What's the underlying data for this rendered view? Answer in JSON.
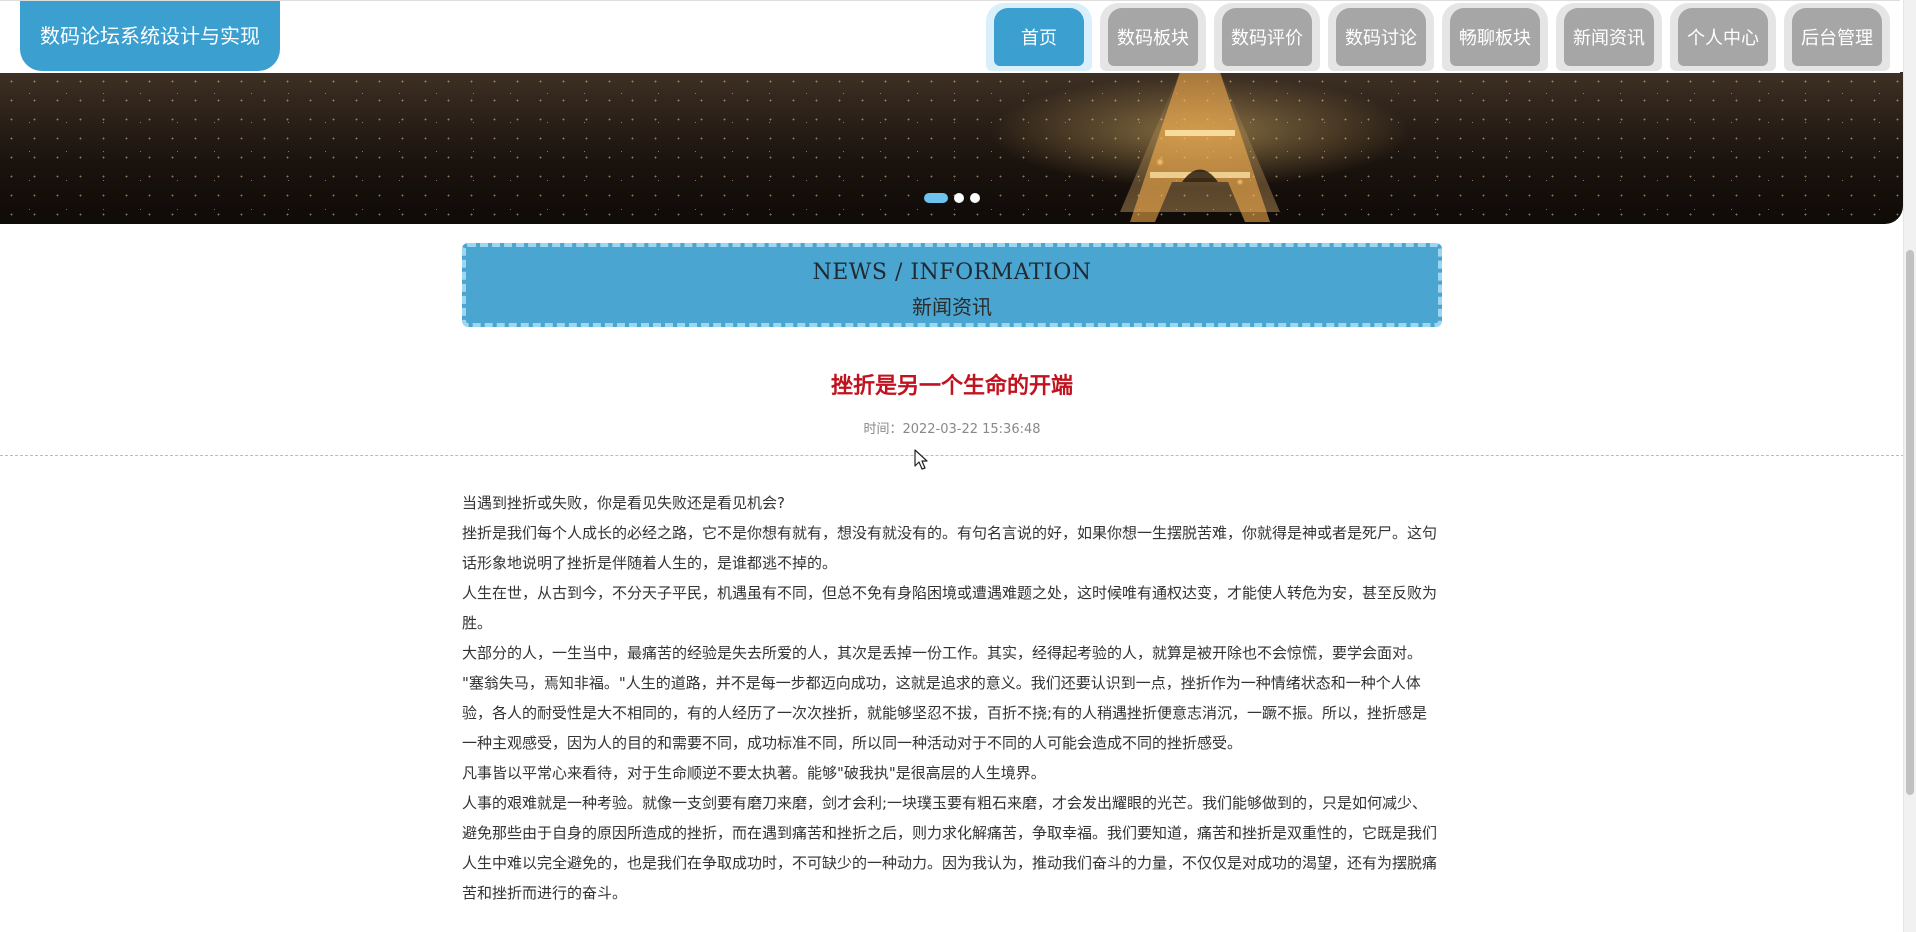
{
  "header": {
    "brand": "数码论坛系统设计与实现",
    "nav": [
      {
        "label": "首页",
        "active": true
      },
      {
        "label": "数码板块"
      },
      {
        "label": "数码评价"
      },
      {
        "label": "数码讨论"
      },
      {
        "label": "畅聊板块"
      },
      {
        "label": "新闻资讯"
      },
      {
        "label": "个人中心"
      },
      {
        "label": "后台管理"
      }
    ]
  },
  "banner": {
    "slides_count": 3,
    "active_index": 0
  },
  "section": {
    "title_en": "NEWS / INFORMATION",
    "title_zh": "新闻资讯"
  },
  "article": {
    "title": "挫折是另一个生命的开端",
    "time": "时间：2022-03-22 15:36:48",
    "paragraphs": [
      "当遇到挫折或失败，你是看见失败还是看见机会?",
      "挫折是我们每个人成长的必经之路，它不是你想有就有，想没有就没有的。有句名言说的好，如果你想一生摆脱苦难，你就得是神或者是死尸。这句话形象地说明了挫折是伴随着人生的，是谁都逃不掉的。",
      "人生在世，从古到今，不分天子平民，机遇虽有不同，但总不免有身陷困境或遭遇难题之处，这时候唯有通权达变，才能使人转危为安，甚至反败为胜。",
      "大部分的人，一生当中，最痛苦的经验是失去所爱的人，其次是丢掉一份工作。其实，经得起考验的人，就算是被开除也不会惊慌，要学会面对。",
      "\"塞翁失马，焉知非福。\"人生的道路，并不是每一步都迈向成功，这就是追求的意义。我们还要认识到一点，挫折作为一种情绪状态和一种个人体验，各人的耐受性是大不相同的，有的人经历了一次次挫折，就能够坚忍不拔，百折不挠;有的人稍遇挫折便意志消沉，一蹶不振。所以，挫折感是一种主观感受，因为人的目的和需要不同，成功标准不同，所以同一种活动对于不同的人可能会造成不同的挫折感受。",
      "凡事皆以平常心来看待，对于生命顺逆不要太执著。能够\"破我执\"是很高层的人生境界。",
      "人事的艰难就是一种考验。就像一支剑要有磨刀来磨，剑才会利;一块璞玉要有粗石来磨，才会发出耀眼的光芒。我们能够做到的，只是如何减少、避免那些由于自身的原因所造成的挫折，而在遇到痛苦和挫折之后，则力求化解痛苦，争取幸福。我们要知道，痛苦和挫折是双重性的，它既是我们人生中难以完全避免的，也是我们在争取成功时，不可缺少的一种动力。因为我认为，推动我们奋斗的力量，不仅仅是对成功的渴望，还有为摆脱痛苦和挫折而进行的奋斗。"
    ]
  }
}
